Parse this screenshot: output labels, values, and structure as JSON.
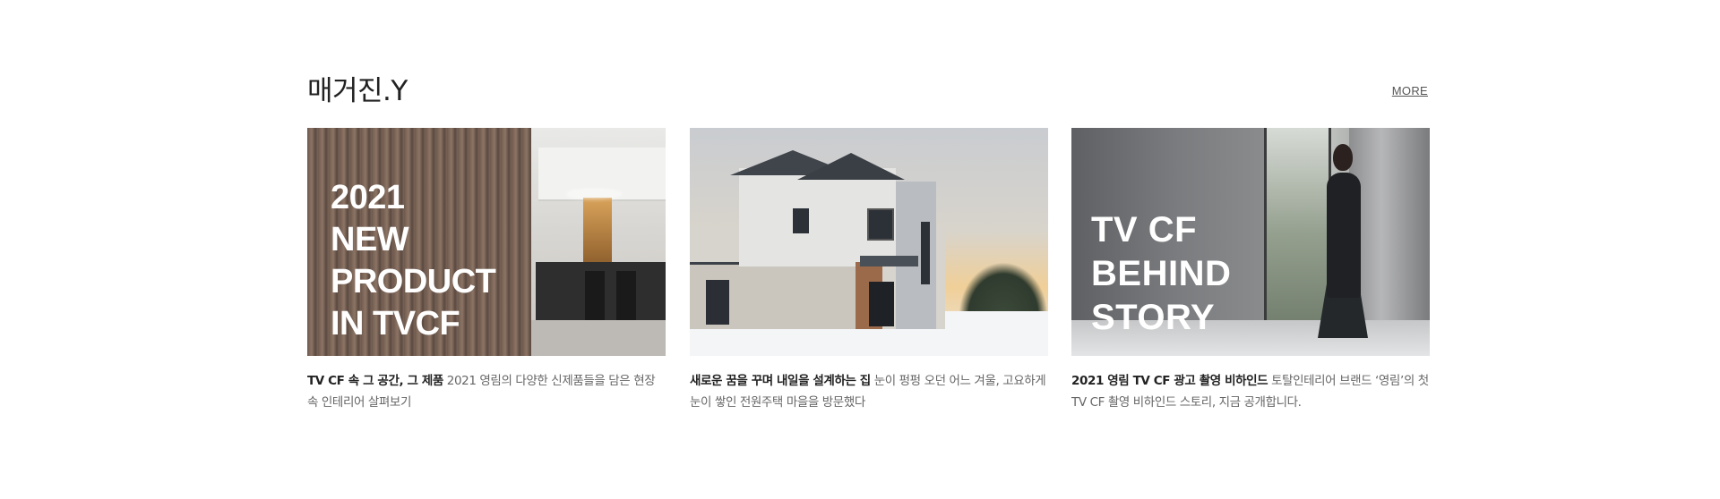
{
  "section": {
    "title": "매거진.Y",
    "more_label": "MORE"
  },
  "cards": [
    {
      "overlay": "2021\nNEW\nPRODUCT\nIN TVCF",
      "caption_bold": "TV CF 속 그 공간, 그 제품",
      "caption_rest": " 2021 영림의 다양한 신제품들을 담은 현장 속 인테리어 살펴보기"
    },
    {
      "overlay": "",
      "caption_bold": "새로운 꿈을 꾸며 내일을 설계하는 집",
      "caption_rest": " 눈이 펑펑 오던 어느 겨울, 고요하게 눈이 쌓인 전원주택 마을을 방문했다"
    },
    {
      "overlay": "TV CF\nBEHIND\nSTORY",
      "caption_bold": "2021 영림 TV CF 광고 촬영 비하인드",
      "caption_rest": " 토탈인테리어 브랜드 ‘영림’의 첫 TV CF 촬영 비하인드 스토리, 지금 공개합니다."
    }
  ]
}
